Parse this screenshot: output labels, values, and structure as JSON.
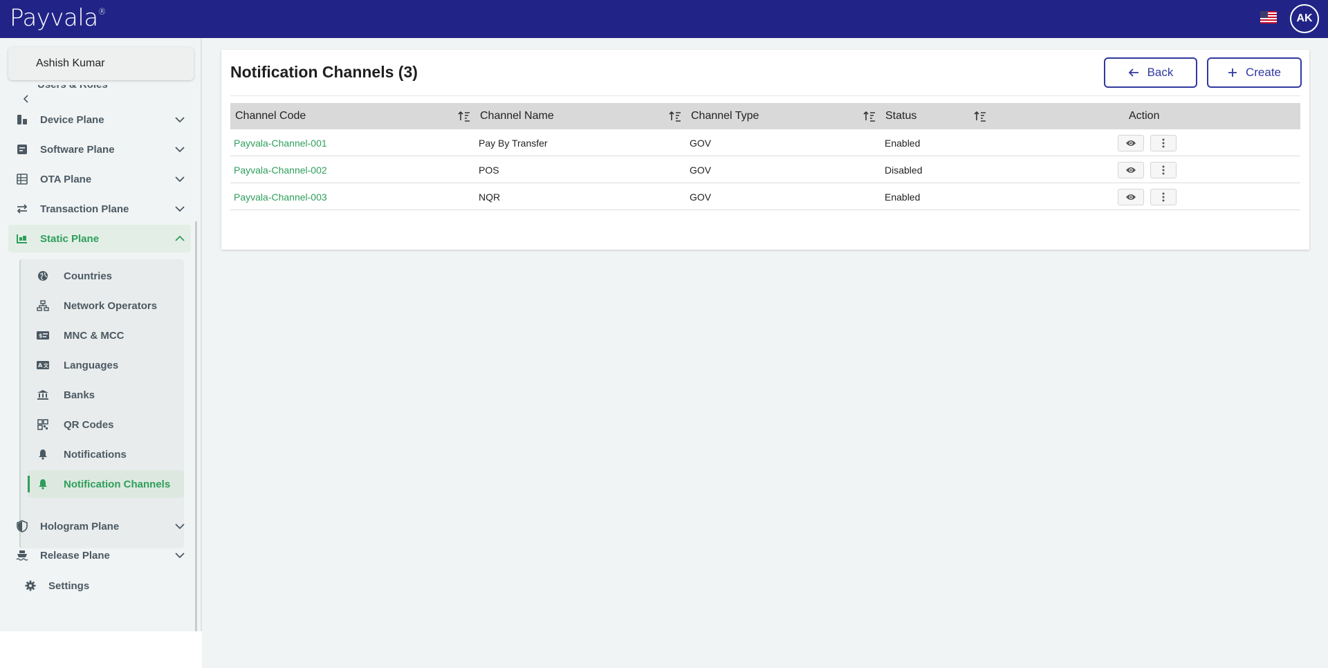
{
  "app": {
    "logo_text": "Payvala",
    "logo_mark": "®",
    "user_initials": "AK",
    "flag_icon": "us-flag-icon"
  },
  "sidebar": {
    "user_name": "Ashish Kumar",
    "partial_item": "Users & Roles",
    "items": [
      {
        "label": "Device Plane",
        "icon": "device-icon"
      },
      {
        "label": "Software Plane",
        "icon": "software-icon"
      },
      {
        "label": "OTA Plane",
        "icon": "ota-icon"
      },
      {
        "label": "Transaction Plane",
        "icon": "transfer-icon"
      },
      {
        "label": "Static Plane",
        "icon": "static-icon"
      }
    ],
    "sub_items": [
      {
        "label": "Countries",
        "icon": "globe-icon"
      },
      {
        "label": "Network Operators",
        "icon": "network-icon"
      },
      {
        "label": "MNC & MCC",
        "icon": "card-icon"
      },
      {
        "label": "Languages",
        "icon": "language-icon"
      },
      {
        "label": "Banks",
        "icon": "bank-icon"
      },
      {
        "label": "QR Codes",
        "icon": "qr-icon"
      },
      {
        "label": "Notifications",
        "icon": "bell-icon"
      },
      {
        "label": "Notification Channels",
        "icon": "bell-icon"
      }
    ],
    "bottom_items": [
      {
        "label": "Hologram Plane",
        "icon": "shield-icon"
      },
      {
        "label": "Release Plane",
        "icon": "ship-icon"
      },
      {
        "label": "Settings",
        "icon": "gear-icon"
      }
    ]
  },
  "page": {
    "title": "Notification Channels (3)",
    "back_label": "Back",
    "create_label": "Create"
  },
  "table": {
    "headers": [
      "Channel Code",
      "Channel Name",
      "Channel Type",
      "Status",
      "Action"
    ],
    "rows": [
      {
        "code": "Payvala-Channel-001",
        "name": "Pay By Transfer",
        "type": "GOV",
        "status": "Enabled"
      },
      {
        "code": "Payvala-Channel-002",
        "name": "POS",
        "type": "GOV",
        "status": "Disabled"
      },
      {
        "code": "Payvala-Channel-003",
        "name": "NQR",
        "type": "GOV",
        "status": "Enabled"
      }
    ]
  },
  "colors": {
    "header_bg": "#212486",
    "accent_green": "#2e9e5b",
    "button_border": "#3038a0",
    "text_grey": "#4b5963"
  }
}
